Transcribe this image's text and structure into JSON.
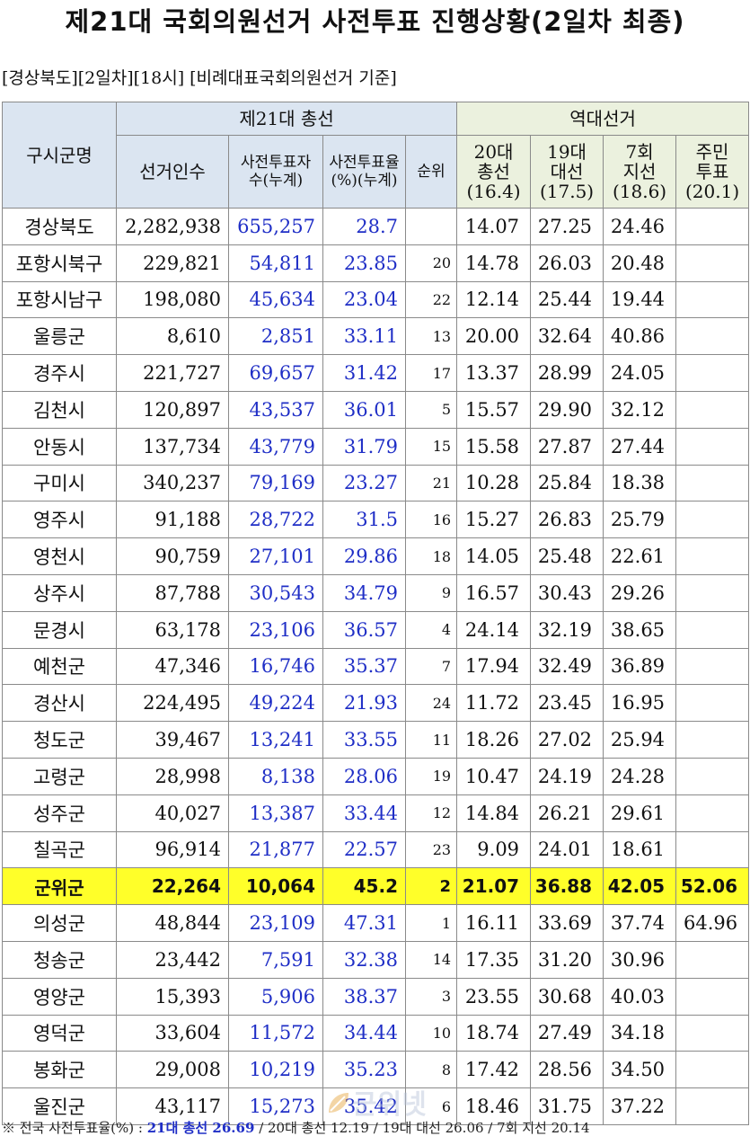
{
  "title": "제21대 국회의원선거 사전투표 진행상황(2일차 최종)",
  "subtitle": "[경상북도][2일차][18시] [비례대표국회의원선거 기준]",
  "header": {
    "region_col": "구시군명",
    "group_current": "제21대 총선",
    "group_history": "역대선거",
    "voters": "선거인수",
    "early_voters_1": "사전투표자",
    "early_voters_2": "수(누계)",
    "rate_1": "사전투표율",
    "rate_2": "(%)(누계)",
    "rank": "순위",
    "h20_1": "20대",
    "h20_2": "총선",
    "h20_3": "(16.4)",
    "h19_1": "19대",
    "h19_2": "대선",
    "h19_3": "(17.5)",
    "h7_1": "7회",
    "h7_2": "지선",
    "h7_3": "(18.6)",
    "hres_1": "주민",
    "hres_2": "투표",
    "hres_3": "(20.1)"
  },
  "rows": [
    {
      "name": "경상북도",
      "voters": "2,282,938",
      "early": "655,257",
      "rate": "28.7",
      "rank": "",
      "e20": "14.07",
      "e19": "27.25",
      "e7": "24.46",
      "res": ""
    },
    {
      "name": "포항시북구",
      "voters": "229,821",
      "early": "54,811",
      "rate": "23.85",
      "rank": "20",
      "e20": "14.78",
      "e19": "26.03",
      "e7": "20.48",
      "res": ""
    },
    {
      "name": "포항시남구",
      "voters": "198,080",
      "early": "45,634",
      "rate": "23.04",
      "rank": "22",
      "e20": "12.14",
      "e19": "25.44",
      "e7": "19.44",
      "res": ""
    },
    {
      "name": "울릉군",
      "voters": "8,610",
      "early": "2,851",
      "rate": "33.11",
      "rank": "13",
      "e20": "20.00",
      "e19": "32.64",
      "e7": "40.86",
      "res": ""
    },
    {
      "name": "경주시",
      "voters": "221,727",
      "early": "69,657",
      "rate": "31.42",
      "rank": "17",
      "e20": "13.37",
      "e19": "28.99",
      "e7": "24.05",
      "res": ""
    },
    {
      "name": "김천시",
      "voters": "120,897",
      "early": "43,537",
      "rate": "36.01",
      "rank": "5",
      "e20": "15.57",
      "e19": "29.90",
      "e7": "32.12",
      "res": ""
    },
    {
      "name": "안동시",
      "voters": "137,734",
      "early": "43,779",
      "rate": "31.79",
      "rank": "15",
      "e20": "15.58",
      "e19": "27.87",
      "e7": "27.44",
      "res": ""
    },
    {
      "name": "구미시",
      "voters": "340,237",
      "early": "79,169",
      "rate": "23.27",
      "rank": "21",
      "e20": "10.28",
      "e19": "25.84",
      "e7": "18.38",
      "res": ""
    },
    {
      "name": "영주시",
      "voters": "91,188",
      "early": "28,722",
      "rate": "31.5",
      "rank": "16",
      "e20": "15.27",
      "e19": "26.83",
      "e7": "25.79",
      "res": ""
    },
    {
      "name": "영천시",
      "voters": "90,759",
      "early": "27,101",
      "rate": "29.86",
      "rank": "18",
      "e20": "14.05",
      "e19": "25.48",
      "e7": "22.61",
      "res": ""
    },
    {
      "name": "상주시",
      "voters": "87,788",
      "early": "30,543",
      "rate": "34.79",
      "rank": "9",
      "e20": "16.57",
      "e19": "30.43",
      "e7": "29.26",
      "res": ""
    },
    {
      "name": "문경시",
      "voters": "63,178",
      "early": "23,106",
      "rate": "36.57",
      "rank": "4",
      "e20": "24.14",
      "e19": "32.19",
      "e7": "38.65",
      "res": ""
    },
    {
      "name": "예천군",
      "voters": "47,346",
      "early": "16,746",
      "rate": "35.37",
      "rank": "7",
      "e20": "17.94",
      "e19": "32.49",
      "e7": "36.89",
      "res": ""
    },
    {
      "name": "경산시",
      "voters": "224,495",
      "early": "49,224",
      "rate": "21.93",
      "rank": "24",
      "e20": "11.72",
      "e19": "23.45",
      "e7": "16.95",
      "res": ""
    },
    {
      "name": "청도군",
      "voters": "39,467",
      "early": "13,241",
      "rate": "33.55",
      "rank": "11",
      "e20": "18.26",
      "e19": "27.02",
      "e7": "25.94",
      "res": ""
    },
    {
      "name": "고령군",
      "voters": "28,998",
      "early": "8,138",
      "rate": "28.06",
      "rank": "19",
      "e20": "10.47",
      "e19": "24.19",
      "e7": "24.28",
      "res": ""
    },
    {
      "name": "성주군",
      "voters": "40,027",
      "early": "13,387",
      "rate": "33.44",
      "rank": "12",
      "e20": "14.84",
      "e19": "26.21",
      "e7": "29.61",
      "res": ""
    },
    {
      "name": "칠곡군",
      "voters": "96,914",
      "early": "21,877",
      "rate": "22.57",
      "rank": "23",
      "e20": "9.09",
      "e19": "24.01",
      "e7": "18.61",
      "res": ""
    },
    {
      "name": "군위군",
      "voters": "22,264",
      "early": "10,064",
      "rate": "45.2",
      "rank": "2",
      "e20": "21.07",
      "e19": "36.88",
      "e7": "42.05",
      "res": "52.06",
      "highlight": true
    },
    {
      "name": "의성군",
      "voters": "48,844",
      "early": "23,109",
      "rate": "47.31",
      "rank": "1",
      "e20": "16.11",
      "e19": "33.69",
      "e7": "37.74",
      "res": "64.96"
    },
    {
      "name": "청송군",
      "voters": "23,442",
      "early": "7,591",
      "rate": "32.38",
      "rank": "14",
      "e20": "17.35",
      "e19": "31.20",
      "e7": "30.96",
      "res": ""
    },
    {
      "name": "영양군",
      "voters": "15,393",
      "early": "5,906",
      "rate": "38.37",
      "rank": "3",
      "e20": "23.55",
      "e19": "30.68",
      "e7": "40.03",
      "res": ""
    },
    {
      "name": "영덕군",
      "voters": "33,604",
      "early": "11,572",
      "rate": "34.44",
      "rank": "10",
      "e20": "18.74",
      "e19": "27.49",
      "e7": "34.18",
      "res": ""
    },
    {
      "name": "봉화군",
      "voters": "29,008",
      "early": "10,219",
      "rate": "35.23",
      "rank": "8",
      "e20": "17.42",
      "e19": "28.56",
      "e7": "34.50",
      "res": ""
    },
    {
      "name": "울진군",
      "voters": "43,117",
      "early": "15,273",
      "rate": "35.42",
      "rank": "6",
      "e20": "18.46",
      "e19": "31.75",
      "e7": "37.22",
      "res": ""
    }
  ],
  "footer": {
    "prefix": "※ 전국 사전투표율(%) :",
    "highlight": "21대 총선 26.69",
    "rest": "/ 20대 총선 12.19 / 19대 대선 26.06 / 7회 지선 20.14"
  },
  "watermark": "군위넷",
  "colors": {
    "header_blue": "#dbe5f1",
    "header_green": "#ebf1de",
    "highlight_row": "#ffff29",
    "blue_text": "#1f2ec6"
  }
}
